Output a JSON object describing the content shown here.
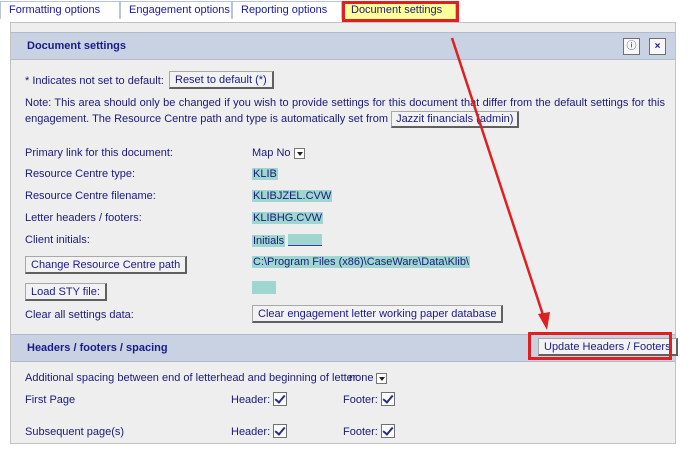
{
  "tabs": [
    {
      "label": "Formatting options",
      "active": false
    },
    {
      "label": "Engagement options",
      "active": false
    },
    {
      "label": "Reporting options",
      "active": false
    },
    {
      "label": "Document settings",
      "active": true
    }
  ],
  "document_settings": {
    "title": "Document settings",
    "info_icon_glyph": "ⓘ",
    "close_icon_glyph": "×",
    "default_note": "* Indicates not set to default:",
    "reset_button": "Reset to default (*)",
    "note_text": "Note: This area should only be changed if you wish to provide settings for this document that differ from the default settings for this engagement. The Resource Centre path and type is automatically set from",
    "jazzit_button": "Jazzit financials (admin)",
    "primary_link_label": "Primary link for this document:",
    "primary_link_value": "Map No",
    "rc_type_label": "Resource Centre type:",
    "rc_type_value": "KLIB",
    "rc_filename_label": "Resource Centre filename:",
    "rc_filename_value": "KLIBJZEL.CVW",
    "letter_headers_label": "Letter headers / footers:",
    "letter_headers_value": "KLIBHG.CVW",
    "client_initials_label": "Client initials:",
    "client_initials_value": "Initials",
    "change_path_button": "Change Resource Centre path",
    "rc_path_value": "C:\\Program Files (x86)\\CaseWare\\Data\\Klib\\",
    "load_sty_button": "Load STY file:",
    "clear_all_label": "Clear all settings data:",
    "clear_db_button": "Clear engagement letter working paper database"
  },
  "headers_footers": {
    "title": "Headers / footers / spacing",
    "update_button": "Update Headers / Footers",
    "spacing_label": "Additional spacing between end of letterhead and beginning of letter:",
    "spacing_value": "none",
    "first_page_label": "First Page",
    "subsequent_label": "Subsequent page(s)",
    "header_label": "Header:",
    "footer_label": "Footer:",
    "first_header_checked": true,
    "first_footer_checked": true,
    "subsequent_header_checked": true,
    "subsequent_footer_checked": true
  },
  "colors": {
    "annotation_red": "#e02020",
    "active_tab": "#ffff99",
    "header_band": "#c8d2e2",
    "field_highlight": "#9fd6d0"
  }
}
